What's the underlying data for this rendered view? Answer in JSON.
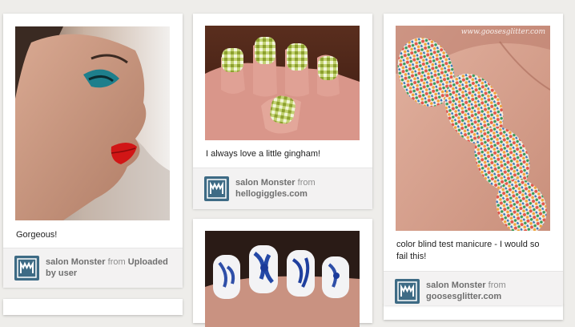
{
  "pins": [
    {
      "description": "Gorgeous!",
      "pinner": "salon Monster",
      "from_word": "from",
      "source": "Uploaded by user",
      "image_subject": "woman-red-lips-photo"
    },
    {
      "description": "I always love a little gingham!",
      "pinner": "salon Monster",
      "from_word": "from",
      "source": "hellogiggles.com",
      "image_subject": "gingham-nails-photo"
    },
    {
      "description": "",
      "pinner": "",
      "from_word": "",
      "source": "",
      "image_subject": "blue-floral-nails-photo"
    },
    {
      "description": "color blind test manicure - I would so fail this!",
      "pinner": "salon Monster",
      "from_word": "from",
      "source": "goosesglitter.com",
      "image_subject": "polka-dot-nails-photo",
      "watermark": "www.goosesglitter.com"
    }
  ],
  "colors": {
    "avatar": "#3e6b85",
    "background": "#eeedea",
    "footer": "#f3f2f2"
  }
}
